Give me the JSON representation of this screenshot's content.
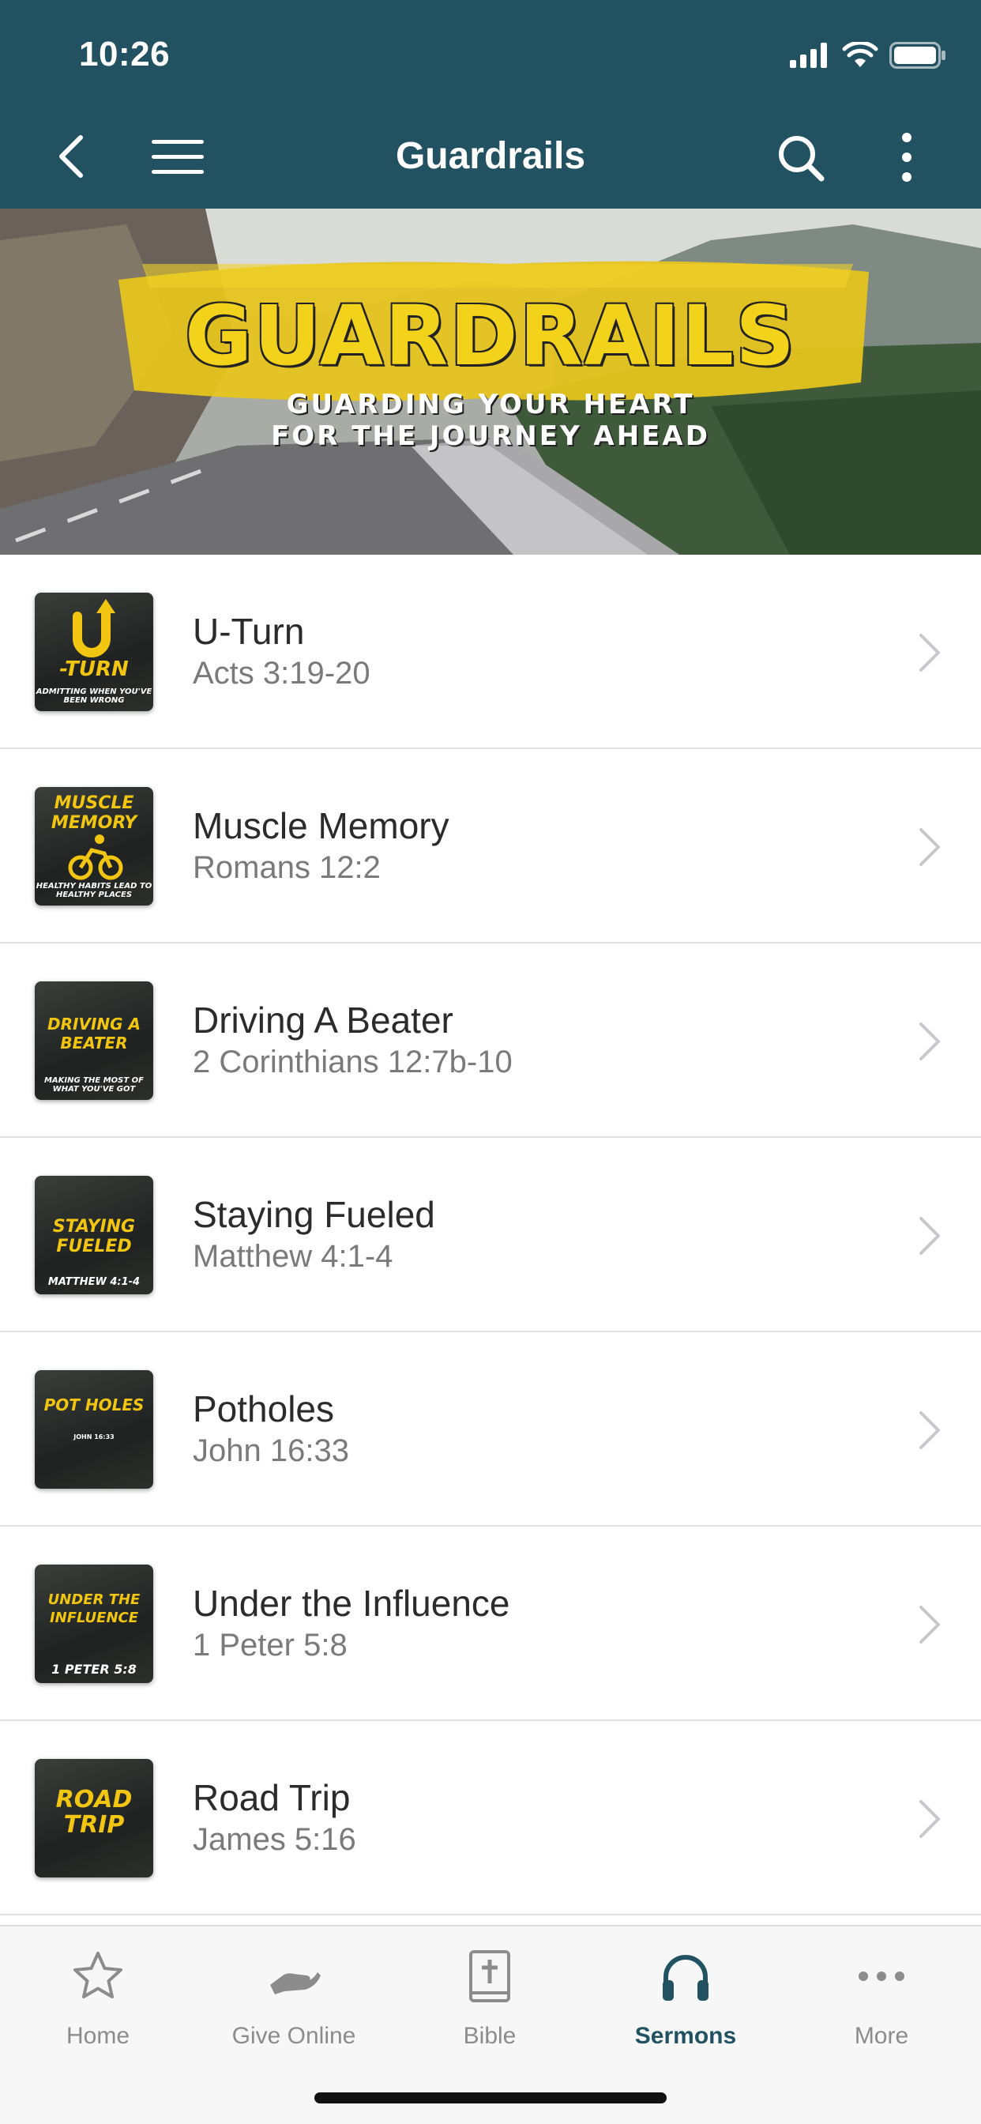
{
  "status_bar": {
    "time": "10:26"
  },
  "header": {
    "title": "Guardrails"
  },
  "banner": {
    "title": "GUARDRAILS",
    "subtitle_line1": "GUARDING YOUR HEART",
    "subtitle_line2": "FOR THE JOURNEY AHEAD"
  },
  "sermons": [
    {
      "title": "U-Turn",
      "reference": "Acts 3:19-20",
      "thumb_text": "-TURN",
      "thumb_foot": "ADMITTING WHEN YOU'VE BEEN WRONG"
    },
    {
      "title": "Muscle Memory",
      "reference": "Romans 12:2",
      "thumb_text": "MUSCLE MEMORY",
      "thumb_foot": "HEALTHY HABITS LEAD TO HEALTHY PLACES"
    },
    {
      "title": "Driving A Beater",
      "reference": "2 Corinthians 12:7b-10",
      "thumb_text": "DRIVING A BEATER",
      "thumb_foot": "MAKING THE MOST OF WHAT YOU'VE GOT"
    },
    {
      "title": "Staying Fueled",
      "reference": "Matthew 4:1-4",
      "thumb_text": "STAYING FUELED",
      "thumb_foot": "MATTHEW 4:1-4"
    },
    {
      "title": "Potholes",
      "reference": "John 16:33",
      "thumb_text": "POT HOLES",
      "thumb_foot": "JOHN 16:33"
    },
    {
      "title": "Under the Influence",
      "reference": "1 Peter 5:8",
      "thumb_text": "UNDER THE INFLUENCE",
      "thumb_foot": "1 PETER 5:8"
    },
    {
      "title": "Road Trip",
      "reference": "James 5:16",
      "thumb_text": "ROAD TRIP",
      "thumb_foot": ""
    }
  ],
  "tabs": [
    {
      "label": "Home",
      "icon": "star-icon",
      "active": false
    },
    {
      "label": "Give Online",
      "icon": "give-hand-icon",
      "active": false
    },
    {
      "label": "Bible",
      "icon": "bible-icon",
      "active": false
    },
    {
      "label": "Sermons",
      "icon": "headphones-icon",
      "active": true
    },
    {
      "label": "More",
      "icon": "more-dots-icon",
      "active": false
    }
  ],
  "colors": {
    "header_bg": "#225262",
    "accent": "#225262",
    "thumb_yellow": "#f2c511"
  }
}
